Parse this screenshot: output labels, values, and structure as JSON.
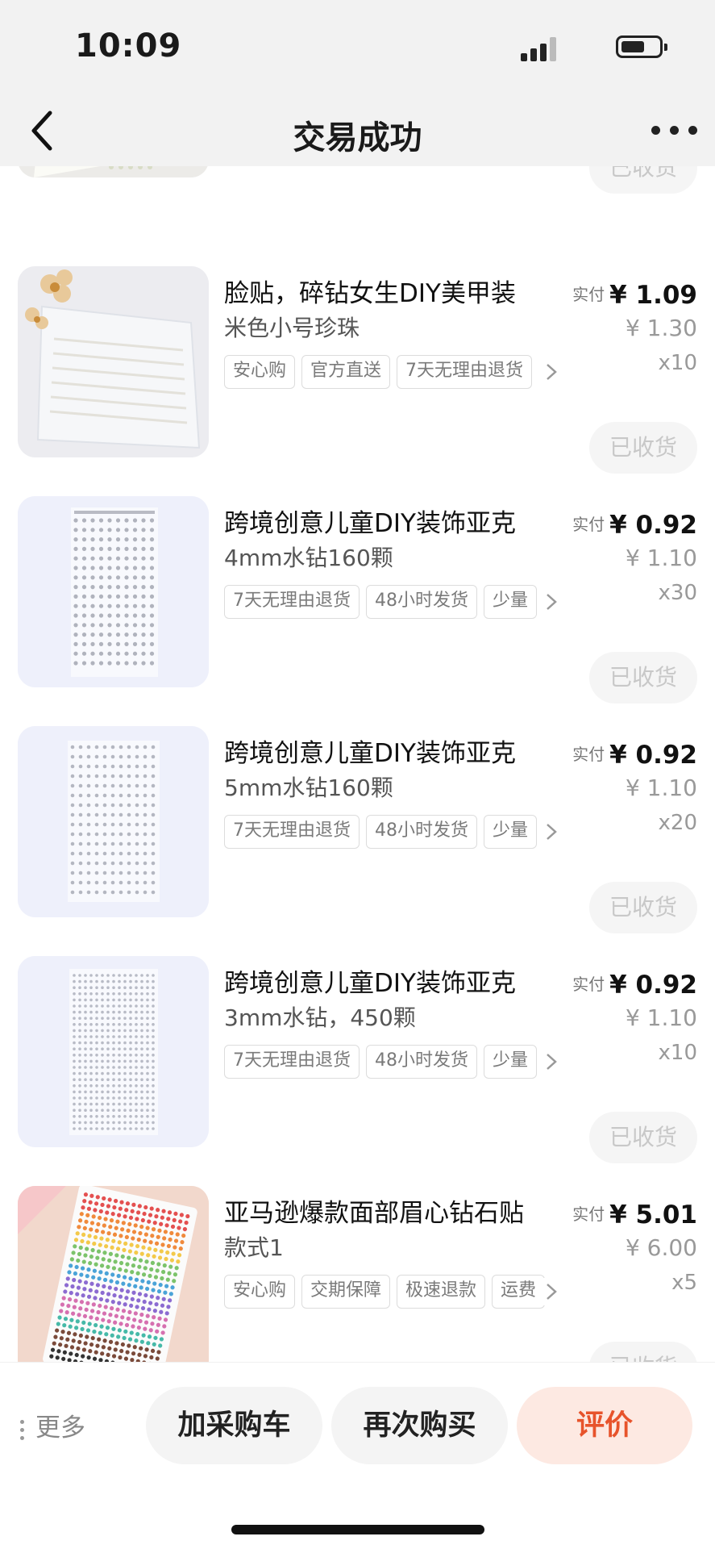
{
  "status_bar": {
    "time": "10:09"
  },
  "nav": {
    "title": "交易成功"
  },
  "items": [
    {
      "title": "",
      "spec": "",
      "tags": [],
      "paid_label": "",
      "paid": "",
      "original": "",
      "qty": "",
      "status": "已收货"
    },
    {
      "title": "脸贴，碎钻女生DIY美甲装",
      "spec": "米色小号珍珠",
      "tags": [
        "安心购",
        "官方直送",
        "7天无理由退货"
      ],
      "paid_label": "实付",
      "paid": "¥ 1.09",
      "original": "¥ 1.30",
      "qty": "x10",
      "status": "已收货"
    },
    {
      "title": "跨境创意儿童DIY装饰亚克",
      "spec": "4mm水钻160颗",
      "tags": [
        "7天无理由退货",
        "48小时发货",
        "少量"
      ],
      "paid_label": "实付",
      "paid": "¥ 0.92",
      "original": "¥ 1.10",
      "qty": "x30",
      "status": "已收货"
    },
    {
      "title": "跨境创意儿童DIY装饰亚克",
      "spec": "5mm水钻160颗",
      "tags": [
        "7天无理由退货",
        "48小时发货",
        "少量"
      ],
      "paid_label": "实付",
      "paid": "¥ 0.92",
      "original": "¥ 1.10",
      "qty": "x20",
      "status": "已收货"
    },
    {
      "title": "跨境创意儿童DIY装饰亚克",
      "spec": "3mm水钻，450颗",
      "tags": [
        "7天无理由退货",
        "48小时发货",
        "少量"
      ],
      "paid_label": "实付",
      "paid": "¥ 0.92",
      "original": "¥ 1.10",
      "qty": "x10",
      "status": "已收货"
    },
    {
      "title": "亚马逊爆款面部眉心钻石贴",
      "spec": "款式1",
      "tags": [
        "安心购",
        "交期保障",
        "极速退款",
        "运费"
      ],
      "paid_label": "实付",
      "paid": "¥ 5.01",
      "original": "¥ 6.00",
      "qty": "x5",
      "status": "已收货"
    }
  ],
  "bottom_bar": {
    "more": "更多",
    "add_cart": "加采购车",
    "buy_again": "再次购买",
    "review": "评价"
  },
  "colors": {
    "accent": "#e7532b",
    "accent_bg": "#fde9e2"
  }
}
